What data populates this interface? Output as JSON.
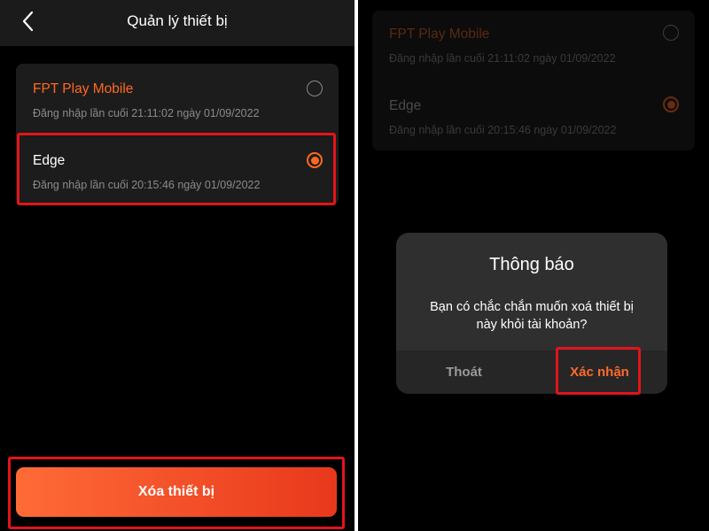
{
  "left_screen": {
    "header": {
      "title": "Quản lý thiết bị",
      "back_icon": "chevron-left-icon"
    },
    "devices": [
      {
        "name": "FPT Play Mobile",
        "last_login": "Đăng nhập lần cuối 21:11:02 ngày 01/09/2022",
        "selected": false
      },
      {
        "name": "Edge",
        "last_login": "Đăng nhập lần cuối 20:15:46 ngày 01/09/2022",
        "selected": true
      }
    ],
    "delete_button": "Xóa thiết bị"
  },
  "right_screen": {
    "devices": [
      {
        "name": "FPT Play Mobile",
        "last_login": "Đăng nhập lần cuối 21:11:02 ngày 01/09/2022",
        "selected": false
      },
      {
        "name": "Edge",
        "last_login": "Đăng nhập lần cuối 20:15:46 ngày 01/09/2022",
        "selected": true
      }
    ],
    "dialog": {
      "title": "Thông báo",
      "message_line1": "Bạn có chắc chắn muốn xoá thiết bị",
      "message_line2": "này khỏi tài khoản?",
      "cancel_label": "Thoát",
      "confirm_label": "Xác nhận"
    }
  },
  "colors": {
    "accent": "#ff6a1f",
    "highlight_box": "#e3141a",
    "background": "#000000",
    "card": "#1c1c1c",
    "dialog": "#2f2f30"
  }
}
